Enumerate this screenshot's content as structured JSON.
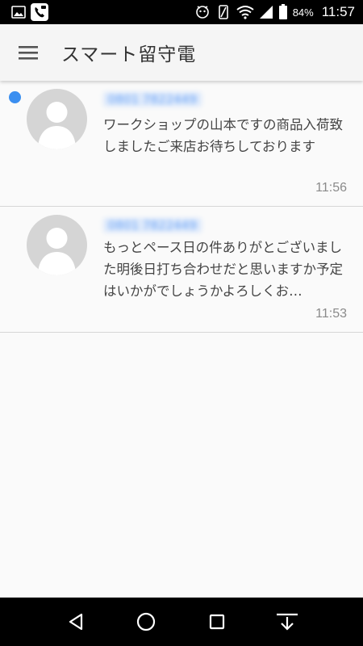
{
  "status_bar": {
    "icons_left": [
      "image-icon",
      "voicemail-app-icon"
    ],
    "icons_right": [
      "notification-icon",
      "vibrate-icon",
      "wifi-icon",
      "signal-icon",
      "battery-icon"
    ],
    "battery_percent": "84%",
    "time": "11:57"
  },
  "app_bar": {
    "title": "スマート留守電"
  },
  "messages": [
    {
      "unread": true,
      "caller": "0801 7822449",
      "text": "ワークショップの山本ですの商品入荷致しましたご来店お待ちしております",
      "time": "11:56"
    },
    {
      "unread": false,
      "caller": "0801 7822449",
      "text": "もっとペース日の件ありがとございました明後日打ち合わせだと思いますか予定はいかがでしょうかよろしくお…",
      "time": "11:53"
    }
  ],
  "colors": {
    "accent": "#3b8ff0",
    "status_bar": "#000000",
    "app_bar": "#f5f5f5",
    "background": "#fafafa"
  }
}
